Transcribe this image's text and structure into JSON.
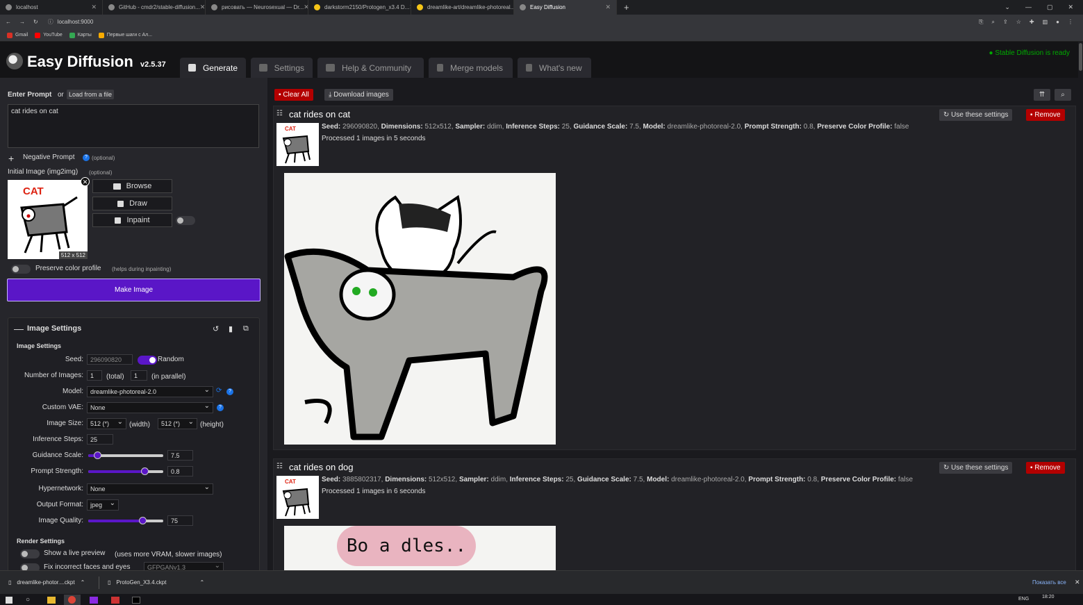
{
  "browser": {
    "tabs": [
      {
        "label": "localhost",
        "active": false
      },
      {
        "label": "GitHub - cmdr2/stable-diffusion...",
        "active": false
      },
      {
        "label": "рисовать — Neurosexual — Dr...",
        "active": false
      },
      {
        "label": "darkstorm2150/Protogen_x3.4 D...",
        "active": false
      },
      {
        "label": "dreamlike-art/dreamlike-photoreal...",
        "active": false
      },
      {
        "label": "Easy Diffusion",
        "active": true
      }
    ],
    "url": "localhost:9000",
    "bookmarks": [
      {
        "label": "Gmail",
        "color": "#d93025"
      },
      {
        "label": "YouTube",
        "color": "#ff0000"
      },
      {
        "label": "Карты",
        "color": "#34a853"
      },
      {
        "label": "Первые шаги с Ал...",
        "color": "#f9ab00"
      }
    ]
  },
  "app": {
    "title": "Easy Diffusion",
    "version": "v2.5.37",
    "status": "Stable Diffusion is ready",
    "status_color": "#00aa00",
    "accent": "#5a16c7",
    "nav": [
      {
        "label": "Generate",
        "active": true
      },
      {
        "label": "Settings",
        "active": false
      },
      {
        "label": "Help & Community",
        "active": false
      },
      {
        "label": "Merge models",
        "active": false
      },
      {
        "label": "What's new",
        "active": false
      }
    ]
  },
  "left": {
    "prompt_label": "Enter Prompt",
    "or_label": "or",
    "load_file": "Load from a file",
    "prompt_value": "cat rides on cat",
    "negative_label": "Negative Prompt",
    "optional": "(optional)",
    "initial_image_label": "Initial Image (img2img)",
    "image_size_badge": "512 x 512",
    "browse": "Browse",
    "draw": "Draw",
    "inpaint": "Inpaint",
    "preserve_label": "Preserve color profile",
    "preserve_hint": "(helps during inpainting)",
    "make_image": "Make Image",
    "settings_title": "Image Settings",
    "settings_subtitle": "Image Settings",
    "seed_label": "Seed:",
    "seed_value": "296090820",
    "random_label": "Random",
    "num_images_label": "Number of Images:",
    "num_total": "1",
    "total_hint": "(total)",
    "num_parallel": "1",
    "parallel_hint": "(in parallel)",
    "model_label": "Model:",
    "model_value": "dreamlike-photoreal-2.0",
    "vae_label": "Custom VAE:",
    "vae_value": "None",
    "size_label": "Image Size:",
    "width_value": "512 (*)",
    "width_hint": "(width)",
    "height_value": "512 (*)",
    "height_hint": "(height)",
    "steps_label": "Inference Steps:",
    "steps_value": "25",
    "guidance_label": "Guidance Scale:",
    "guidance_value": "7.5",
    "guidance_fraction": 0.12,
    "strength_label": "Prompt Strength:",
    "strength_value": "0.8",
    "strength_fraction": 0.75,
    "hypernetwork_label": "Hypernetwork:",
    "hypernetwork_value": "None",
    "format_label": "Output Format:",
    "format_value": "jpeg",
    "quality_label": "Image Quality:",
    "quality_value": "75",
    "quality_fraction": 0.72,
    "render_title": "Render Settings",
    "live_preview_label": "Show a live preview",
    "live_preview_hint": "(uses more VRAM, slower images)",
    "fix_faces_label": "Fix incorrect faces and eyes",
    "fix_faces_value": "GFPGANv1.3"
  },
  "right": {
    "clear_all": "Clear All",
    "download_images": "Download images",
    "tasks": [
      {
        "title": "cat rides on cat",
        "use_settings": "Use these settings",
        "remove": "Remove",
        "seed": "296090820",
        "dimensions": "512x512",
        "sampler": "ddim",
        "steps": "25",
        "guidance": "7.5",
        "model": "dreamlike-photoreal-2.0",
        "strength": "0.8",
        "preserve": "false",
        "processed": "Processed 1 images in 5 seconds"
      },
      {
        "title": "cat rides on dog",
        "use_settings": "Use these settings",
        "remove": "Remove",
        "seed": "3885802317",
        "dimensions": "512x512",
        "sampler": "ddim",
        "steps": "25",
        "guidance": "7.5",
        "model": "dreamlike-photoreal-2.0",
        "strength": "0.8",
        "preserve": "false",
        "processed": "Processed 1 images in 6 seconds",
        "image_text": "Bo a dles.."
      }
    ],
    "labels": {
      "seed": "Seed:",
      "dimensions": "Dimensions:",
      "sampler": "Sampler:",
      "steps": "Inference Steps:",
      "guidance": "Guidance Scale:",
      "model": "Model:",
      "strength": "Prompt Strength:",
      "preserve": "Preserve Color Profile:"
    }
  },
  "downloads": {
    "files": [
      "dreamlike-photor....ckpt",
      "ProtoGen_X3.4.ckpt"
    ],
    "show_all": "Показать все"
  },
  "taskbar": {
    "lang": "ENG",
    "time": "18:20"
  },
  "thumb_text": "CAT"
}
